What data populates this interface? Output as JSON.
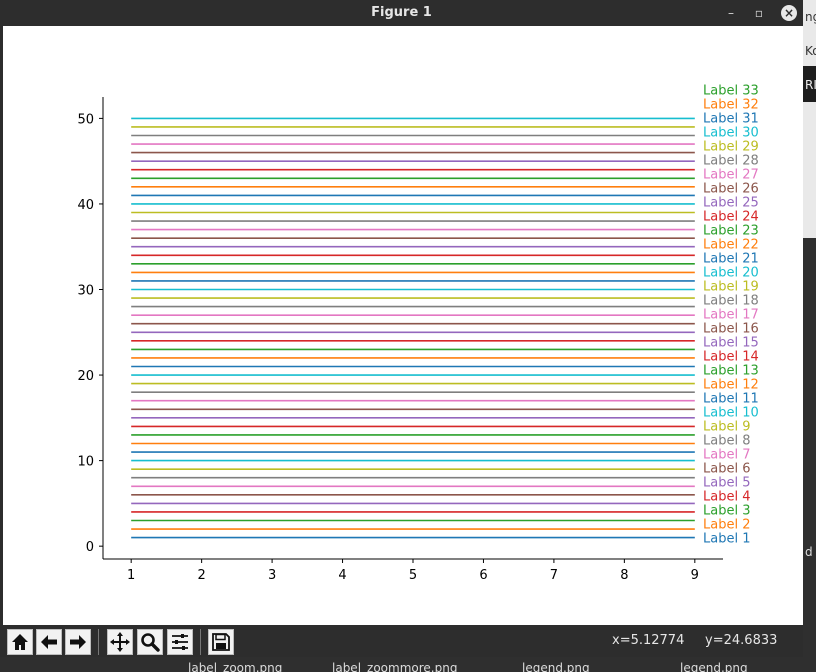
{
  "window": {
    "title": "Figure 1",
    "minimize_glyph": "–",
    "restore_glyph": "▫",
    "close_glyph": "×"
  },
  "toolbar": {
    "buttons": [
      {
        "name": "home-icon",
        "label": "Home"
      },
      {
        "name": "back-arrow-icon",
        "label": "Back"
      },
      {
        "name": "forward-arrow-icon",
        "label": "Forward"
      },
      {
        "name": "pan-icon",
        "label": "Pan"
      },
      {
        "name": "zoom-icon",
        "label": "Zoom"
      },
      {
        "name": "configure-subplots-icon",
        "label": "Configure"
      },
      {
        "name": "save-icon",
        "label": "Save"
      }
    ],
    "coord_x": "x=5.12774",
    "coord_y": "y=24.6833"
  },
  "desktop": {
    "right_fragments": [
      "ng",
      "Ko",
      "RI",
      "d"
    ],
    "bottom_files": [
      "label_zoom.png",
      "label_zoommore.png",
      "legend.png",
      "legend.png"
    ]
  },
  "colors": {
    "tab10": [
      "#1f77b4",
      "#ff7f0e",
      "#2ca02c",
      "#d62728",
      "#9467bd",
      "#8c564b",
      "#e377c2",
      "#7f7f7f",
      "#bcbd22",
      "#17becf"
    ]
  },
  "chart_data": {
    "type": "line",
    "title": "",
    "xlabel": "",
    "ylabel": "",
    "xlim": [
      0.6,
      9.4
    ],
    "ylim": [
      -1.5,
      52.5
    ],
    "x": [
      1,
      9
    ],
    "xticks": [
      1,
      2,
      3,
      4,
      5,
      6,
      7,
      8,
      9
    ],
    "yticks": [
      0,
      10,
      20,
      30,
      40,
      50
    ],
    "grid": false,
    "series_note_values": [
      1,
      2,
      3,
      4,
      5,
      6,
      7,
      8,
      9,
      10,
      11,
      12,
      13,
      14,
      15,
      16,
      17,
      18,
      19,
      20,
      21,
      22,
      23,
      24,
      25,
      26,
      27,
      28,
      29,
      30,
      31,
      32,
      33,
      34,
      35,
      36,
      37,
      38,
      39,
      40,
      41,
      42,
      43,
      44,
      45,
      46,
      47,
      48,
      49,
      50
    ],
    "end_labels": [
      {
        "text": "Label 1",
        "value": 1
      },
      {
        "text": "Label 2",
        "value": 2
      },
      {
        "text": "Label 3",
        "value": 3
      },
      {
        "text": "Label 4",
        "value": 4
      },
      {
        "text": "Label 5",
        "value": 5
      },
      {
        "text": "Label 6",
        "value": 6
      },
      {
        "text": "Label 7",
        "value": 7
      },
      {
        "text": "Label 8",
        "value": 8
      },
      {
        "text": "Label 9",
        "value": 9
      },
      {
        "text": "Label 10",
        "value": 10
      },
      {
        "text": "Label 11",
        "value": 11
      },
      {
        "text": "Label 12",
        "value": 12
      },
      {
        "text": "Label 13",
        "value": 13
      },
      {
        "text": "Label 14",
        "value": 14
      },
      {
        "text": "Label 15",
        "value": 15
      },
      {
        "text": "Label 16",
        "value": 16
      },
      {
        "text": "Label 17",
        "value": 17
      },
      {
        "text": "Label 18",
        "value": 18
      },
      {
        "text": "Label 19",
        "value": 19
      },
      {
        "text": "Label 20",
        "value": 20
      },
      {
        "text": "Label 21",
        "value": 21
      },
      {
        "text": "Label 22",
        "value": 22
      },
      {
        "text": "Label 23",
        "value": 23
      },
      {
        "text": "Label 24",
        "value": 24
      },
      {
        "text": "Label 25",
        "value": 25
      },
      {
        "text": "Label 26",
        "value": 26
      },
      {
        "text": "Label 27",
        "value": 27
      },
      {
        "text": "Label 28",
        "value": 28
      },
      {
        "text": "Label 29",
        "value": 29
      },
      {
        "text": "Label 30",
        "value": 30
      },
      {
        "text": "Label 31",
        "value": 31
      },
      {
        "text": "Label 32",
        "value": 32
      },
      {
        "text": "Label 33",
        "value": 33
      }
    ]
  }
}
